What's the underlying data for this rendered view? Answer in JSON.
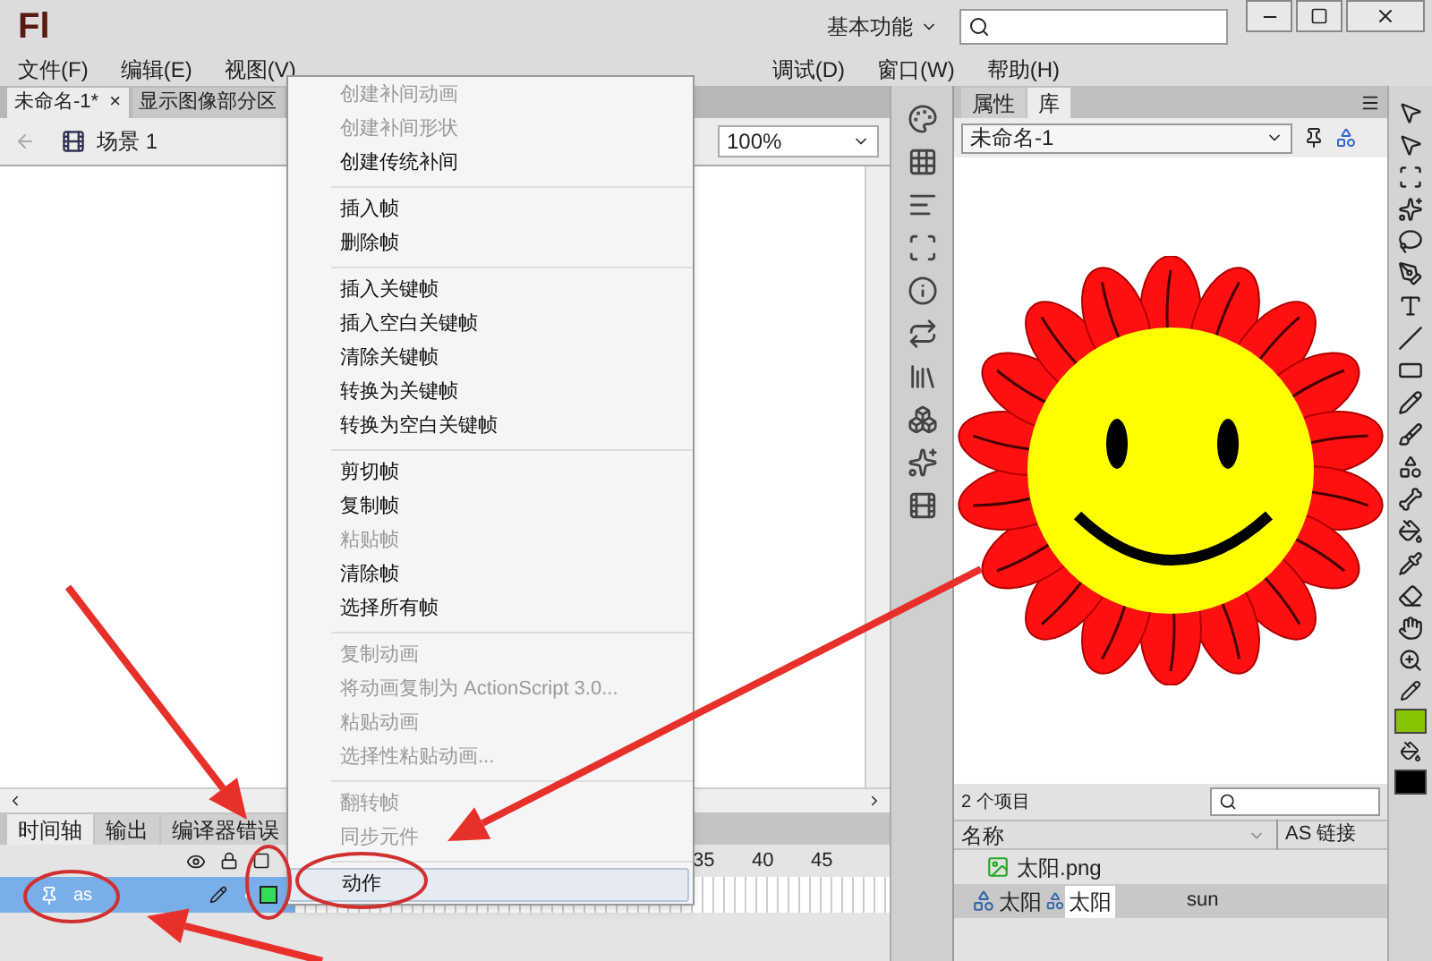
{
  "app": {
    "logo": "Fl",
    "workspace": "基本功能"
  },
  "menubar_left": [
    "文件(F)",
    "编辑(E)",
    "视图(V)"
  ],
  "menubar_right": [
    "调试(D)",
    "窗口(W)",
    "帮助(H)"
  ],
  "doc_tabs": [
    {
      "label": "未命名-1*",
      "close": "×",
      "selected": true
    },
    {
      "label": "显示图像部分区",
      "selected": false
    }
  ],
  "scene": {
    "label": "场景 1",
    "zoom": "100%"
  },
  "context_menu": [
    [
      {
        "label": "创建补间动画",
        "disabled": true,
        "highlighted": false
      },
      {
        "label": "创建补间形状",
        "disabled": true,
        "highlighted": false
      },
      {
        "label": "创建传统补间",
        "disabled": false,
        "highlighted": false
      }
    ],
    [
      {
        "label": "插入帧",
        "disabled": false,
        "highlighted": false
      },
      {
        "label": "删除帧",
        "disabled": false,
        "highlighted": false
      }
    ],
    [
      {
        "label": "插入关键帧",
        "disabled": false,
        "highlighted": false
      },
      {
        "label": "插入空白关键帧",
        "disabled": false,
        "highlighted": false
      },
      {
        "label": "清除关键帧",
        "disabled": false,
        "highlighted": false
      },
      {
        "label": "转换为关键帧",
        "disabled": false,
        "highlighted": false
      },
      {
        "label": "转换为空白关键帧",
        "disabled": false,
        "highlighted": false
      }
    ],
    [
      {
        "label": "剪切帧",
        "disabled": false,
        "highlighted": false
      },
      {
        "label": "复制帧",
        "disabled": false,
        "highlighted": false
      },
      {
        "label": "粘贴帧",
        "disabled": true,
        "highlighted": false
      },
      {
        "label": "清除帧",
        "disabled": false,
        "highlighted": false
      },
      {
        "label": "选择所有帧",
        "disabled": false,
        "highlighted": false
      }
    ],
    [
      {
        "label": "复制动画",
        "disabled": true,
        "highlighted": false
      },
      {
        "label": "将动画复制为 ActionScript 3.0...",
        "disabled": true,
        "highlighted": false
      },
      {
        "label": "粘贴动画",
        "disabled": true,
        "highlighted": false
      },
      {
        "label": "选择性粘贴动画...",
        "disabled": true,
        "highlighted": false
      }
    ],
    [
      {
        "label": "翻转帧",
        "disabled": true,
        "highlighted": false
      },
      {
        "label": "同步元件",
        "disabled": true,
        "highlighted": false
      }
    ],
    [
      {
        "label": "动作",
        "disabled": false,
        "highlighted": true
      }
    ]
  ],
  "timeline": {
    "tabs": [
      {
        "label": "时间轴",
        "selected": true
      },
      {
        "label": "输出",
        "selected": false
      },
      {
        "label": "编译器错误",
        "selected": false
      }
    ],
    "frame_numbers": [
      "35",
      "40",
      "45"
    ],
    "layers": [
      {
        "name": "as",
        "selected": true
      }
    ]
  },
  "library": {
    "tabs": [
      {
        "label": "属性",
        "selected": false
      },
      {
        "label": "库",
        "selected": true
      }
    ],
    "document": "未命名-1",
    "count": "2 个项目",
    "columns": [
      "名称",
      "AS 链接"
    ],
    "items": [
      {
        "kind": "bitmap",
        "name": "太阳.png",
        "selected": false
      },
      {
        "kind": "symbol",
        "name": "太阳",
        "rename": "太阳",
        "linkage": "sun",
        "selected": true
      }
    ]
  }
}
